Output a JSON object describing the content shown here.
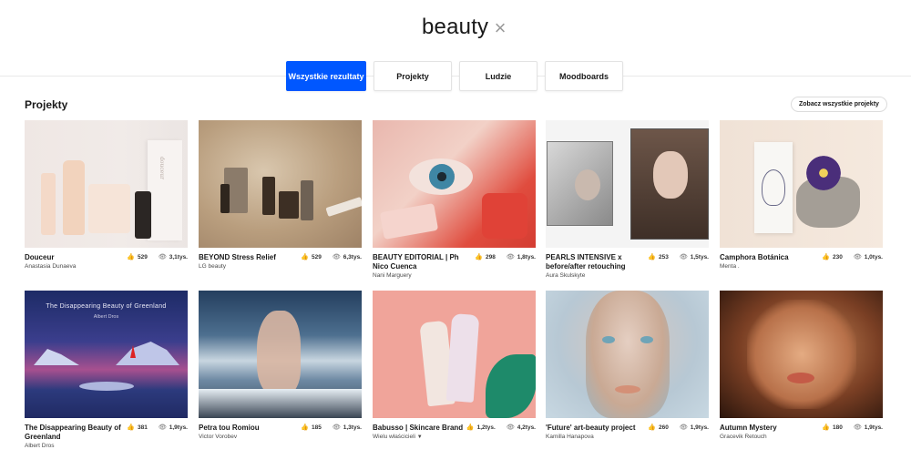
{
  "search": {
    "term": "beauty",
    "clear_icon": "×"
  },
  "tabs": [
    {
      "label": "Wszystkie rezultaty",
      "active": true
    },
    {
      "label": "Projekty",
      "active": false
    },
    {
      "label": "Ludzie",
      "active": false
    },
    {
      "label": "Moodboards",
      "active": false
    }
  ],
  "section": {
    "title": "Projekty",
    "see_all": "Zobacz wszystkie projekty"
  },
  "icons": {
    "like": "thumbs-up-icon",
    "view": "eye-icon",
    "dropdown": "caret-down-icon"
  },
  "colors": {
    "accent": "#0057ff"
  },
  "projects": [
    {
      "title": "Douceur",
      "owner": "Anastasia Dunaeva",
      "likes": "529",
      "views": "3,1tys."
    },
    {
      "title": "BEYOND Stress Relief",
      "owner": "LG beauty",
      "likes": "529",
      "views": "6,3tys."
    },
    {
      "title": "BEAUTY EDITORIAL | Ph Nico Cuenca",
      "owner": "Nani Marguery",
      "likes": "298",
      "views": "1,8tys."
    },
    {
      "title": "PEARLS INTENSIVE x before/after retouching",
      "owner": "Aura Skulskyte",
      "likes": "253",
      "views": "1,5tys."
    },
    {
      "title": "Camphora Botánica",
      "owner": "Menta .",
      "likes": "230",
      "views": "1,0tys."
    },
    {
      "title": "The Disappearing Beauty of Greenland",
      "owner": "Albert Dros",
      "likes": "381",
      "views": "1,9tys.",
      "image_text": "The Disappearing Beauty of Greenland",
      "image_subtext": "Albert Dros"
    },
    {
      "title": "Petra tou Romiou",
      "owner": "Victor Vorobev",
      "likes": "185",
      "views": "1,3tys."
    },
    {
      "title": "Babusso | Skincare Brand",
      "owner": "Wielu właścicieli",
      "likes": "1,2tys.",
      "views": "4,2tys."
    },
    {
      "title": "'Future' art-beauty project",
      "owner": "Kamilla Hanapova",
      "likes": "260",
      "views": "1,9tys."
    },
    {
      "title": "Autumn Mystery",
      "owner": "Gracevik Retouch",
      "likes": "180",
      "views": "1,9tys."
    }
  ],
  "product_label": "douceur"
}
